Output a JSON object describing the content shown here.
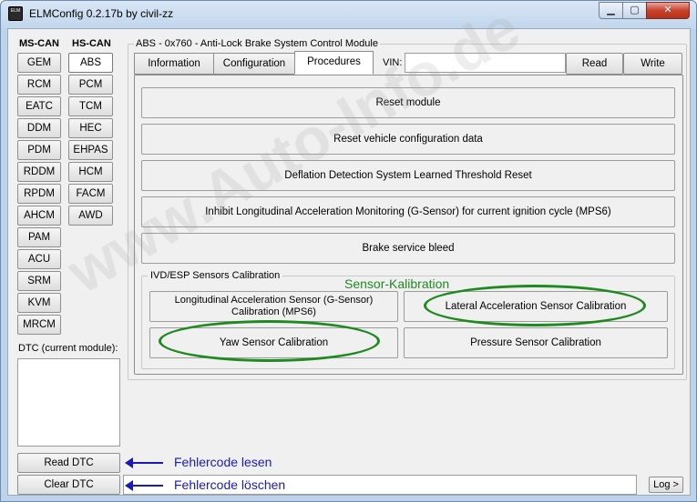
{
  "window": {
    "title": "ELMConfig 0.2.17b by civil-zz",
    "icon_text": "ELM",
    "controls": {
      "minimize": "▁",
      "maximize": "▢",
      "close": "✕"
    }
  },
  "modules": {
    "ms_can_header": "MS-CAN",
    "hs_can_header": "HS-CAN",
    "ms_can": [
      "GEM",
      "RCM",
      "EATC",
      "DDM",
      "PDM",
      "RDDM",
      "RPDM",
      "AHCM",
      "PAM",
      "ACU",
      "SRM",
      "KVM",
      "MRCM"
    ],
    "hs_can": [
      "ABS",
      "PCM",
      "TCM",
      "HEC",
      "EHPAS",
      "HCM",
      "FACM",
      "AWD"
    ],
    "selected": "ABS"
  },
  "dtc": {
    "label": "DTC (current module):",
    "read_label": "Read DTC",
    "clear_label": "Clear DTC",
    "log_label": "Log >"
  },
  "module_panel": {
    "title": "ABS - 0x760 - Anti-Lock Brake System Control Module",
    "tabs": [
      "Information",
      "Configuration",
      "Procedures"
    ],
    "active_tab": "Procedures",
    "vin_label": "VIN:",
    "vin_value": "",
    "read_label": "Read",
    "write_label": "Write"
  },
  "procedures": [
    "Reset module",
    "Reset vehicle configuration data",
    "Deflation Detection System Learned Threshold Reset",
    "Inhibit Longitudinal Acceleration Monitoring (G-Sensor) for current ignition cycle (MPS6)",
    "Brake service bleed"
  ],
  "sensor_calibration": {
    "group_label": "IVD/ESP Sensors Calibration",
    "buttons": [
      "Longitudinal Acceleration Sensor (G-Sensor) Calibration (MPS6)",
      "Lateral Acceleration Sensor Calibration",
      "Yaw Sensor Calibration",
      "Pressure Sensor Calibration"
    ]
  },
  "annotations": {
    "sensor_kalibration": "Sensor-Kalibration",
    "read_dtc": "Fehlercode lesen",
    "clear_dtc": "Fehlercode löschen",
    "highlight_color": "#1f8a1f",
    "arrow_color": "#1a1ab4"
  },
  "watermark": "www.Auto-Info.de"
}
